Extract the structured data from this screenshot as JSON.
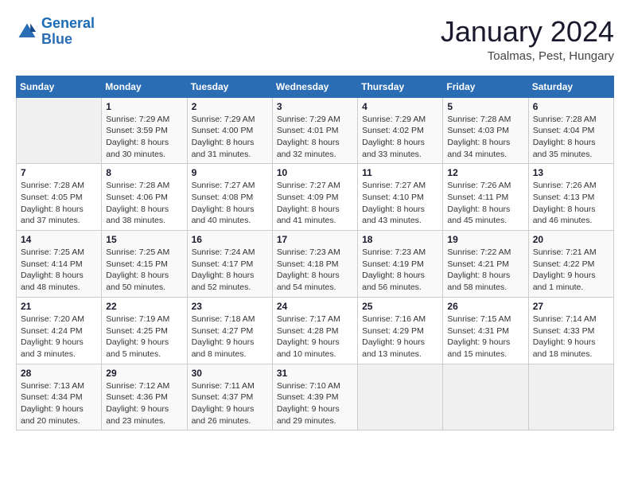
{
  "header": {
    "logo_line1": "General",
    "logo_line2": "Blue",
    "month_year": "January 2024",
    "location": "Toalmas, Pest, Hungary"
  },
  "weekdays": [
    "Sunday",
    "Monday",
    "Tuesday",
    "Wednesday",
    "Thursday",
    "Friday",
    "Saturday"
  ],
  "weeks": [
    [
      {
        "day": "",
        "info": ""
      },
      {
        "day": "1",
        "info": "Sunrise: 7:29 AM\nSunset: 3:59 PM\nDaylight: 8 hours\nand 30 minutes."
      },
      {
        "day": "2",
        "info": "Sunrise: 7:29 AM\nSunset: 4:00 PM\nDaylight: 8 hours\nand 31 minutes."
      },
      {
        "day": "3",
        "info": "Sunrise: 7:29 AM\nSunset: 4:01 PM\nDaylight: 8 hours\nand 32 minutes."
      },
      {
        "day": "4",
        "info": "Sunrise: 7:29 AM\nSunset: 4:02 PM\nDaylight: 8 hours\nand 33 minutes."
      },
      {
        "day": "5",
        "info": "Sunrise: 7:28 AM\nSunset: 4:03 PM\nDaylight: 8 hours\nand 34 minutes."
      },
      {
        "day": "6",
        "info": "Sunrise: 7:28 AM\nSunset: 4:04 PM\nDaylight: 8 hours\nand 35 minutes."
      }
    ],
    [
      {
        "day": "7",
        "info": "Sunrise: 7:28 AM\nSunset: 4:05 PM\nDaylight: 8 hours\nand 37 minutes."
      },
      {
        "day": "8",
        "info": "Sunrise: 7:28 AM\nSunset: 4:06 PM\nDaylight: 8 hours\nand 38 minutes."
      },
      {
        "day": "9",
        "info": "Sunrise: 7:27 AM\nSunset: 4:08 PM\nDaylight: 8 hours\nand 40 minutes."
      },
      {
        "day": "10",
        "info": "Sunrise: 7:27 AM\nSunset: 4:09 PM\nDaylight: 8 hours\nand 41 minutes."
      },
      {
        "day": "11",
        "info": "Sunrise: 7:27 AM\nSunset: 4:10 PM\nDaylight: 8 hours\nand 43 minutes."
      },
      {
        "day": "12",
        "info": "Sunrise: 7:26 AM\nSunset: 4:11 PM\nDaylight: 8 hours\nand 45 minutes."
      },
      {
        "day": "13",
        "info": "Sunrise: 7:26 AM\nSunset: 4:13 PM\nDaylight: 8 hours\nand 46 minutes."
      }
    ],
    [
      {
        "day": "14",
        "info": "Sunrise: 7:25 AM\nSunset: 4:14 PM\nDaylight: 8 hours\nand 48 minutes."
      },
      {
        "day": "15",
        "info": "Sunrise: 7:25 AM\nSunset: 4:15 PM\nDaylight: 8 hours\nand 50 minutes."
      },
      {
        "day": "16",
        "info": "Sunrise: 7:24 AM\nSunset: 4:17 PM\nDaylight: 8 hours\nand 52 minutes."
      },
      {
        "day": "17",
        "info": "Sunrise: 7:23 AM\nSunset: 4:18 PM\nDaylight: 8 hours\nand 54 minutes."
      },
      {
        "day": "18",
        "info": "Sunrise: 7:23 AM\nSunset: 4:19 PM\nDaylight: 8 hours\nand 56 minutes."
      },
      {
        "day": "19",
        "info": "Sunrise: 7:22 AM\nSunset: 4:21 PM\nDaylight: 8 hours\nand 58 minutes."
      },
      {
        "day": "20",
        "info": "Sunrise: 7:21 AM\nSunset: 4:22 PM\nDaylight: 9 hours\nand 1 minute."
      }
    ],
    [
      {
        "day": "21",
        "info": "Sunrise: 7:20 AM\nSunset: 4:24 PM\nDaylight: 9 hours\nand 3 minutes."
      },
      {
        "day": "22",
        "info": "Sunrise: 7:19 AM\nSunset: 4:25 PM\nDaylight: 9 hours\nand 5 minutes."
      },
      {
        "day": "23",
        "info": "Sunrise: 7:18 AM\nSunset: 4:27 PM\nDaylight: 9 hours\nand 8 minutes."
      },
      {
        "day": "24",
        "info": "Sunrise: 7:17 AM\nSunset: 4:28 PM\nDaylight: 9 hours\nand 10 minutes."
      },
      {
        "day": "25",
        "info": "Sunrise: 7:16 AM\nSunset: 4:29 PM\nDaylight: 9 hours\nand 13 minutes."
      },
      {
        "day": "26",
        "info": "Sunrise: 7:15 AM\nSunset: 4:31 PM\nDaylight: 9 hours\nand 15 minutes."
      },
      {
        "day": "27",
        "info": "Sunrise: 7:14 AM\nSunset: 4:33 PM\nDaylight: 9 hours\nand 18 minutes."
      }
    ],
    [
      {
        "day": "28",
        "info": "Sunrise: 7:13 AM\nSunset: 4:34 PM\nDaylight: 9 hours\nand 20 minutes."
      },
      {
        "day": "29",
        "info": "Sunrise: 7:12 AM\nSunset: 4:36 PM\nDaylight: 9 hours\nand 23 minutes."
      },
      {
        "day": "30",
        "info": "Sunrise: 7:11 AM\nSunset: 4:37 PM\nDaylight: 9 hours\nand 26 minutes."
      },
      {
        "day": "31",
        "info": "Sunrise: 7:10 AM\nSunset: 4:39 PM\nDaylight: 9 hours\nand 29 minutes."
      },
      {
        "day": "",
        "info": ""
      },
      {
        "day": "",
        "info": ""
      },
      {
        "day": "",
        "info": ""
      }
    ]
  ]
}
